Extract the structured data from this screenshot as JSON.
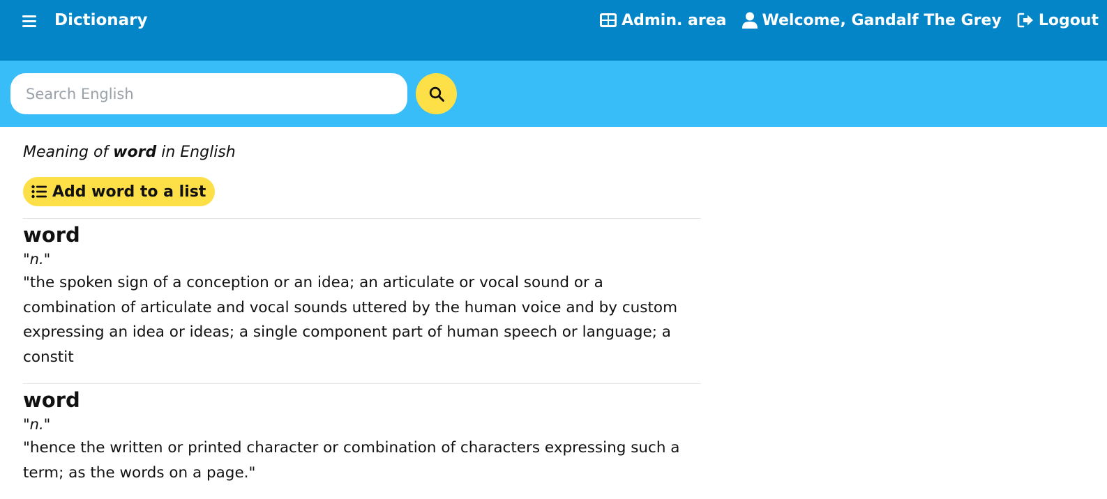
{
  "header": {
    "menu_icon": "hamburger-icon",
    "brand": "Dictionary",
    "nav": [
      {
        "icon": "table-icon",
        "label": "Admin. area"
      },
      {
        "icon": "user-icon",
        "label": "Welcome, Gandalf The Grey"
      },
      {
        "icon": "logout-icon",
        "label": "Logout"
      }
    ]
  },
  "search": {
    "placeholder": "Search English",
    "value": "",
    "button_icon": "search-icon"
  },
  "meaning": {
    "prefix": "Meaning of",
    "word": "word",
    "suffix": "in English"
  },
  "add_button": {
    "icon": "list-icon",
    "label": "Add word to a list"
  },
  "entries": [
    {
      "word": "word",
      "pos_open": "\"",
      "pos": "n.",
      "pos_close": "\"",
      "definition": "\"the spoken sign of a conception or an idea; an articulate or vocal sound or a combination of articulate and vocal sounds uttered by the human voice and by custom expressing an idea or ideas; a single component part of human speech or language; a constit"
    },
    {
      "word": "word",
      "pos_open": "\"",
      "pos": "n.",
      "pos_close": "\"",
      "definition": "\"hence the written or printed character or combination of characters expressing such a term; as the words on a page.\""
    }
  ],
  "colors": {
    "topbar": "#0485c8",
    "searchbar": "#38bdf8",
    "accent": "#fde047"
  }
}
